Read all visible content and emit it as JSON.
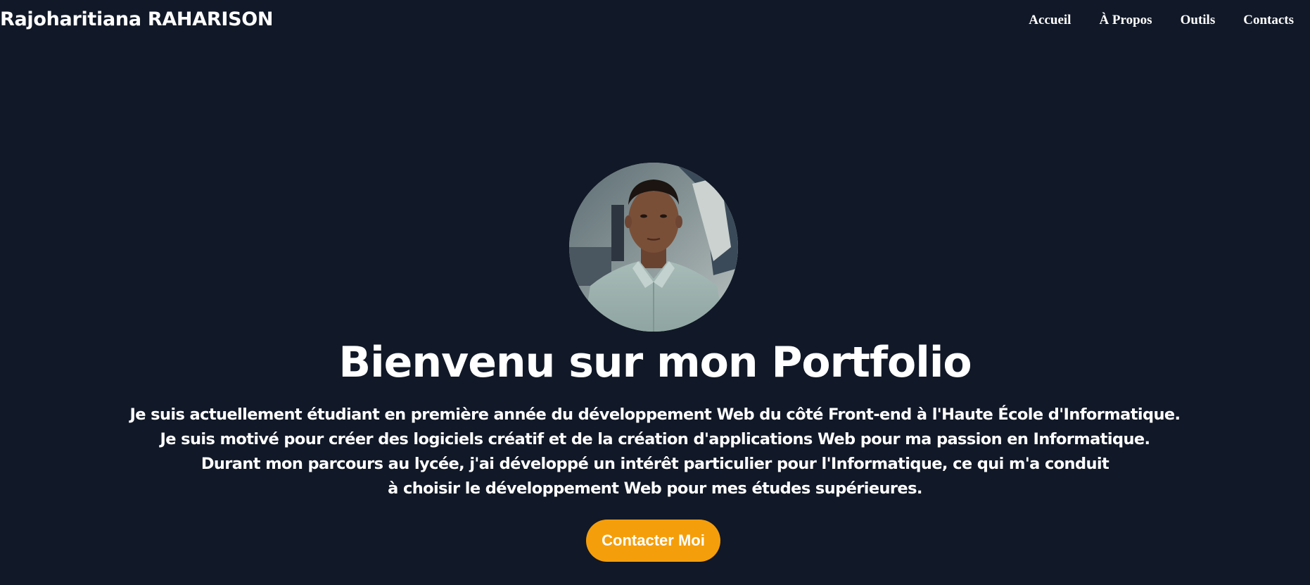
{
  "header": {
    "brand": "Rajoharitiana RAHARISON",
    "nav": [
      {
        "label": "Accueil"
      },
      {
        "label": "À Propos"
      },
      {
        "label": "Outils"
      },
      {
        "label": "Contacts"
      }
    ]
  },
  "hero": {
    "title": "Bienvenu sur mon Portfolio",
    "lines": [
      "Je suis actuellement étudiant en première année du développement Web du côté Front-end à l'Haute École d'Informatique.",
      "Je suis motivé pour créer des logiciels créatif et de la création d'applications Web pour ma passion en Informatique.",
      "Durant mon parcours au lycée, j'ai développé un intérêt particulier pour l'Informatique, ce qui m'a conduit",
      "à choisir le développement Web pour mes études supérieures."
    ],
    "cta_label": "Contacter Moi"
  },
  "colors": {
    "background": "#111827",
    "text": "#ffffff",
    "accent": "#f59e0b"
  }
}
